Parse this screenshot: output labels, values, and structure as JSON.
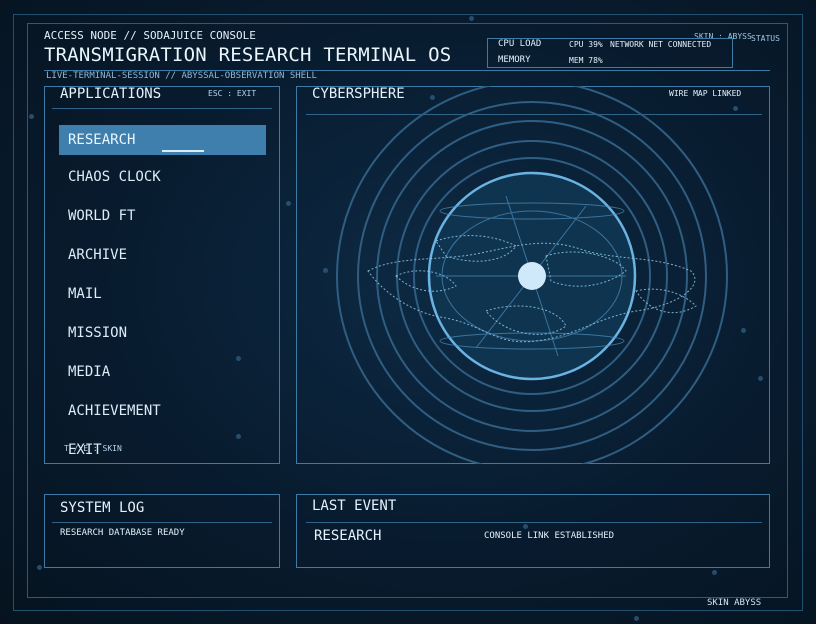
{
  "header": {
    "node": "ACCESS NODE // SODAJUICE CONSOLE",
    "title": "TRANSMIGRATION RESEARCH TERMINAL OS",
    "session": "LIVE-TERMINAL-SESSION // ABYSSAL-OBSERVATION SHELL",
    "skin": "SKIN : ABYSS",
    "status_label": "STATUS"
  },
  "status_panel": {
    "cpu_label": "CPU LOAD",
    "cpu_value": "CPU 39%",
    "network_value": "NETWORK NET CONNECTED",
    "memory_label": "MEMORY",
    "memory_value": "MEM 78%"
  },
  "applications": {
    "title": "APPLICATIONS",
    "hint": "ESC : EXIT",
    "items": [
      {
        "label": "RESEARCH",
        "active": true
      },
      {
        "label": "CHAOS CLOCK"
      },
      {
        "label": "WORLD FT"
      },
      {
        "label": "ARCHIVE"
      },
      {
        "label": "MAIL"
      },
      {
        "label": "MISSION"
      },
      {
        "label": "MEDIA"
      },
      {
        "label": "ACHIEVEMENT"
      },
      {
        "label": "EXIT"
      }
    ],
    "footer_hint": "T / E : SKIN"
  },
  "cybersphere": {
    "title": "CYBERSPHERE",
    "status": "WIRE MAP LINKED"
  },
  "system_log": {
    "title": "SYSTEM LOG",
    "message": "RESEARCH DATABASE READY"
  },
  "last_event": {
    "title": "LAST EVENT",
    "event": "RESEARCH",
    "detail": "CONSOLE LINK ESTABLISHED"
  },
  "footer": {
    "skin": "SKIN ABYSS"
  },
  "colors": {
    "accent": "#3f7fad",
    "border": "#3d7ba6",
    "background": "#081b2e",
    "text": "#cfe6f7"
  }
}
